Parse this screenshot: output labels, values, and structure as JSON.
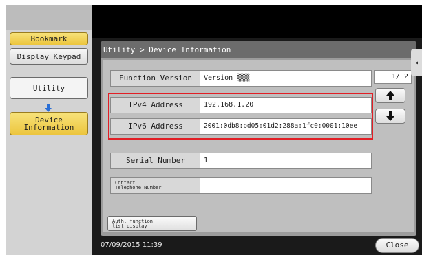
{
  "left_nav": {
    "bookmark": "Bookmark",
    "display_keypad": "Display Keypad",
    "utility": "Utility",
    "device_information": [
      "Device",
      "Information"
    ]
  },
  "breadcrumb": "Utility > Device Information",
  "rows": [
    {
      "label": "Function Version",
      "value": "Version ▒▒▒"
    },
    {
      "label": "IPv4 Address",
      "value": "192.168.1.20"
    },
    {
      "label": "IPv6 Address",
      "value": "2001:0db8:bd05:01d2:288a:1fc0:0001:10ee"
    },
    {
      "label": "Serial Number",
      "value": "1"
    },
    {
      "label": [
        "Contact",
        "Telephone Number"
      ],
      "value": ""
    }
  ],
  "pager": {
    "text": "1/  2"
  },
  "icons": {
    "up": "up-arrow-icon",
    "down": "down-arrow-icon",
    "nav_down": "down-arrow-icon",
    "side_tab": "collapse-arrow-icon"
  },
  "auth_button": [
    "Auth. function",
    "list display"
  ],
  "status": {
    "datetime": "07/09/2015  11:39"
  },
  "close_button": "Close",
  "colors": {
    "yellow": "#ecc53d",
    "highlight": "#e21f26",
    "nav_arrow": "#2a6fd6"
  }
}
